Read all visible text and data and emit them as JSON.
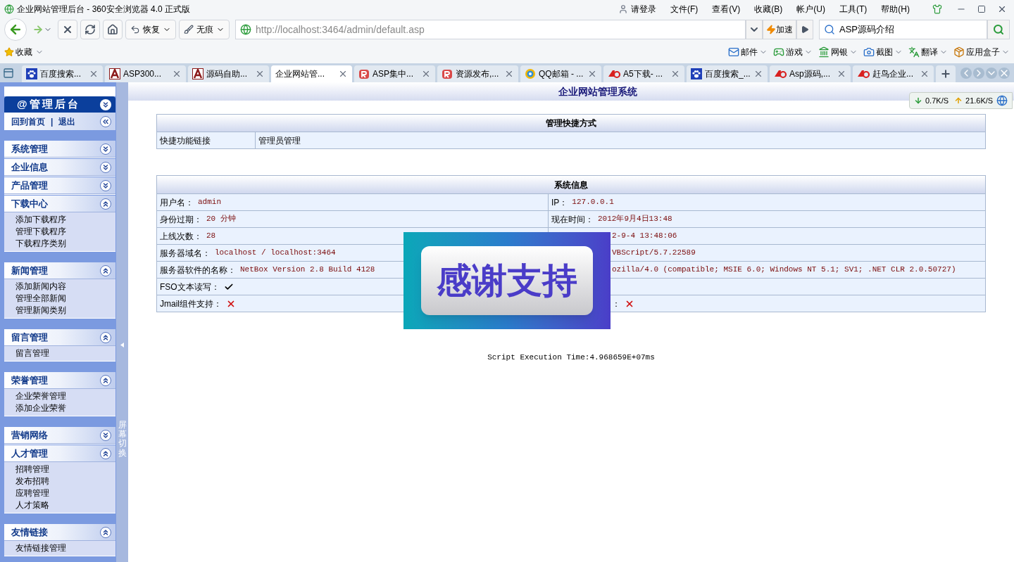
{
  "window": {
    "title": "企业网站管理后台 - 360安全浏览器 4.0 正式版",
    "login": "请登录",
    "menus": [
      "文件(F)",
      "查看(V)",
      "收藏(B)",
      "帐户(U)",
      "工具(T)",
      "帮助(H)"
    ]
  },
  "toolbar": {
    "restore": "恢复",
    "private": "无痕",
    "address": "http://localhost:3464/admin/default.asp",
    "speedup": "加速",
    "search": "ASP源码介绍"
  },
  "favorites": {
    "label": "收藏",
    "tools": [
      {
        "label": "邮件",
        "kind": "mail"
      },
      {
        "label": "游戏",
        "kind": "game"
      },
      {
        "label": "网银",
        "kind": "bank"
      },
      {
        "label": "截图",
        "kind": "capture"
      },
      {
        "label": "翻译",
        "kind": "translate"
      },
      {
        "label": "应用盒子",
        "kind": "box"
      }
    ]
  },
  "tabs": [
    {
      "label": "百度搜索...",
      "kind": "paw",
      "selected": false
    },
    {
      "label": "ASP300...",
      "kind": "a",
      "selected": false
    },
    {
      "label": "源码自助...",
      "kind": "a",
      "selected": false
    },
    {
      "label": "企业网站管...",
      "kind": "none",
      "selected": true
    },
    {
      "label": "ASP集中...",
      "kind": "r",
      "selected": false
    },
    {
      "label": "资源发布,...",
      "kind": "r",
      "selected": false
    },
    {
      "label": "QQ邮箱 - ...",
      "kind": "qq",
      "selected": false
    },
    {
      "label": "A5下载- ...",
      "kind": "a5",
      "selected": false
    },
    {
      "label": "百度搜索_...",
      "kind": "paw",
      "selected": false
    },
    {
      "label": "Asp源码,...",
      "kind": "a5",
      "selected": false
    },
    {
      "label": "赶鸟企业...",
      "kind": "a5",
      "selected": false
    }
  ],
  "speed": {
    "down": "0.7K/S",
    "up": "21.6K/S"
  },
  "sidebar": {
    "title": "@管理后台",
    "home": "回到首页",
    "separator": "|",
    "logout": "退出",
    "toggle": "屏幕切换",
    "groups": [
      [
        {
          "title": "系统管理",
          "expanded": false
        },
        {
          "title": "企业信息",
          "expanded": false
        },
        {
          "title": "产品管理",
          "expanded": false
        },
        {
          "title": "下载中心",
          "expanded": true,
          "items": [
            "添加下载程序",
            "管理下载程序",
            "下载程序类别"
          ]
        }
      ],
      [
        {
          "title": "新闻管理",
          "expanded": true,
          "items": [
            "添加新闻内容",
            "管理全部新闻",
            "管理新闻类别"
          ]
        }
      ],
      [
        {
          "title": "留言管理",
          "expanded": true,
          "items": [
            "留言管理"
          ]
        }
      ],
      [
        {
          "title": "荣誉管理",
          "expanded": true,
          "items": [
            "企业荣誉管理",
            "添加企业荣誉"
          ]
        }
      ],
      [
        {
          "title": "营销网络",
          "expanded": false
        },
        {
          "title": "人才管理",
          "expanded": true,
          "items": [
            "招聘管理",
            "发布招聘",
            "应聘管理",
            "人才策略"
          ]
        }
      ],
      [
        {
          "title": "友情链接",
          "expanded": true,
          "items": [
            "友情链接管理"
          ]
        }
      ]
    ]
  },
  "page": {
    "title": "企业网站管理系统",
    "shortcuts": {
      "title": "管理快捷方式",
      "label": "快捷功能链接",
      "link": "管理员管理"
    },
    "system_info": {
      "title": "系统信息",
      "rows": [
        [
          {
            "label": "用户名：",
            "value": "admin"
          },
          {
            "label": "IP：",
            "value": "127.0.0.1"
          }
        ],
        [
          {
            "label": "身份过期：",
            "value": "20 分钟"
          },
          {
            "label": "现在时间：",
            "value": "2012年9月4日13:48"
          }
        ],
        [
          {
            "label": "上线次数：",
            "value": "28"
          },
          {
            "value": "2-9-4 13:48:06"
          }
        ],
        [
          {
            "label": "服务器域名：",
            "value": "localhost / localhost:3464"
          },
          {
            "value": "VBScript/5.7.22589"
          }
        ],
        [
          {
            "label": "服务器软件的名称：",
            "value": "NetBox Version 2.8 Build 4128"
          },
          {
            "value": "ozilla/4.0 (compatible; MSIE 6.0; Windows NT 5.1; SV1; .NET CLR 2.0.50727)"
          }
        ],
        [
          {
            "label": "FSO文本读写：",
            "supported": true
          },
          {}
        ],
        [
          {
            "label": "Jmail组件支持：",
            "supported": false
          },
          {
            "label": "：",
            "supported": false
          }
        ]
      ]
    },
    "footer": "Script Execution Time:4.968659E+07ms"
  },
  "overlay": {
    "text": "感谢支持"
  }
}
